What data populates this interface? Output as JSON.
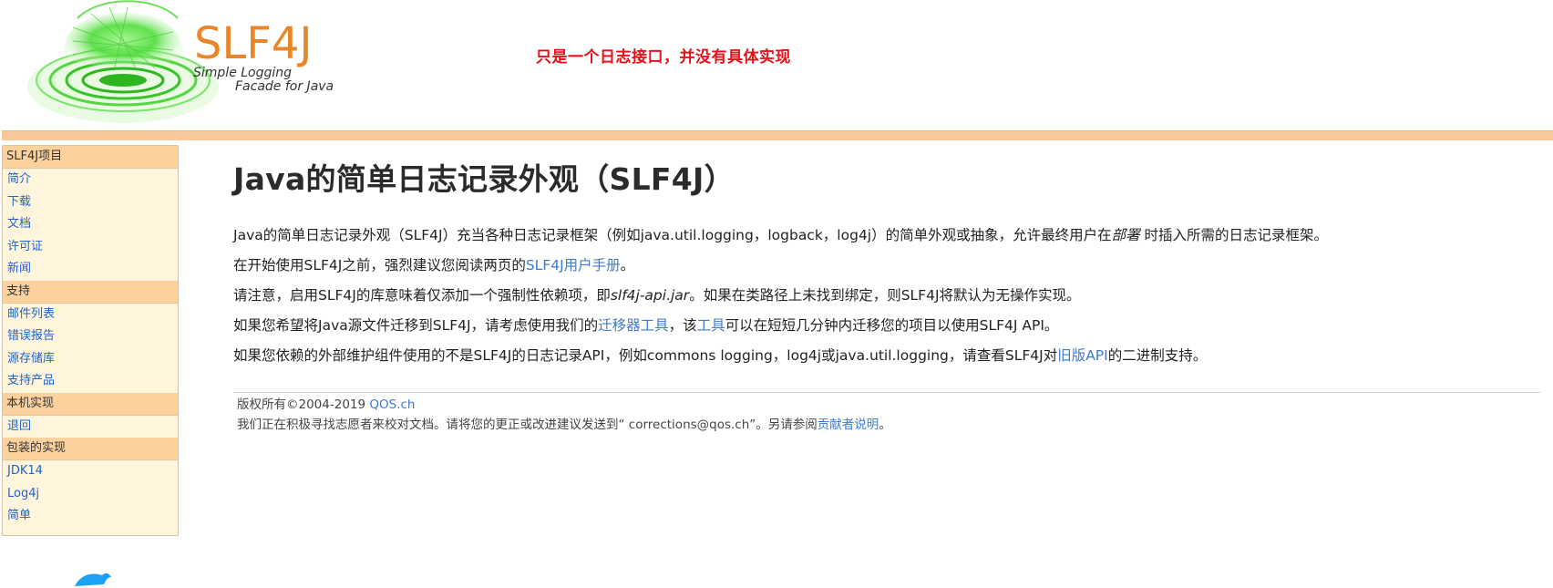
{
  "header": {
    "logo_brand": "SLF4J",
    "logo_sub1": "Simple Logging",
    "logo_sub2": "Facade for Java",
    "tagline": "只是一个日志接口，并没有具体实现"
  },
  "sidebar": {
    "sections": [
      {
        "title": "SLF4J项目",
        "items": [
          "简介",
          "下载",
          "文档",
          "许可证",
          "新闻"
        ]
      },
      {
        "title": "支持",
        "items": [
          "邮件列表",
          "错误报告",
          "源存储库",
          "支持产品"
        ]
      },
      {
        "title": "本机实现",
        "items": [
          "退回"
        ]
      },
      {
        "title": "包装的实现",
        "items": [
          "JDK14",
          "Log4j",
          "简单"
        ]
      }
    ]
  },
  "main": {
    "title": "Java的简单日志记录外观（SLF4J）",
    "p1": {
      "before": "Java的简单日志记录外观（SLF4J）充当各种日志记录框架（例如java.util.logging，logback，log4j）的简单外观或抽象，允许最终用户在",
      "em": "部署",
      "after": " 时插入所需的日志记录框架。"
    },
    "p2": {
      "before": "在开始使用SLF4J之前，强烈建议您阅读两页的",
      "link": "SLF4J用户手册",
      "after": "。"
    },
    "p3": {
      "before": "请注意，启用SLF4J的库意味着仅添加一个强制性依赖项，即",
      "em": "slf4j-api.jar",
      "after": "。如果在类路径上未找到绑定，则SLF4J将默认为无操作实现。"
    },
    "p4": {
      "before": "如果您希望将Java源文件迁移到SLF4J，请考虑使用我们的",
      "link1": "迁移器工具",
      "mid": "，该",
      "link2": "工具",
      "after": "可以在短短几分钟内迁移您的项目以使用SLF4J API。"
    },
    "p5": {
      "before": "如果您依赖的外部维护组件使用的不是SLF4J的日志记录API，例如commons logging，log4j或java.util.logging，请查看SLF4J对",
      "link": "旧版API",
      "after": "的二进制支持。"
    }
  },
  "footer": {
    "copyright": "版权所有©2004-2019 ",
    "company_link": "QOS.ch",
    "volunteer_before": "我们正在积极寻找志愿者来校对文档。请将您的更正或改进建议发送到“ corrections@qos.ch”。另请参阅",
    "contrib_link": "贡献者说明",
    "volunteer_after": "。"
  },
  "colors": {
    "accent_bar": "#f8c89a",
    "section_bg": "#fbd29e",
    "sidebar_bg": "#fff4dc",
    "link": "#3d7bd0",
    "tagline": "#e8101a",
    "logo_orange": "#e8862a",
    "logo_green": "#5ee84a"
  },
  "icons": [
    "slf4j-logo",
    "twitter-icon"
  ]
}
